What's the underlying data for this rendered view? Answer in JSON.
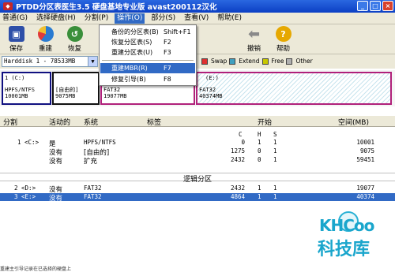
{
  "window": {
    "title": "PTDD分区表医生3.5 硬盘基地专业版 avast200112汉化"
  },
  "menu": [
    "普通(G)",
    "选择硬盘(H)",
    "分割(P)",
    "操作(O)",
    "部分(S)",
    "查看(V)",
    "帮助(E)"
  ],
  "toolbar": [
    {
      "label": "保存",
      "icon": "save-icon",
      "color": "#2e4fa8"
    },
    {
      "label": "重建",
      "icon": "rebuild-pie-icon",
      "color": "#2a7bd1"
    },
    {
      "label": "恢复",
      "icon": "restore-icon",
      "color": "#3a8f3a"
    },
    {
      "label": "撤销",
      "icon": "undo-arrow-icon",
      "color": "#8a8a8a"
    },
    {
      "label": "帮助",
      "icon": "help-icon",
      "color": "#e6a800"
    }
  ],
  "disk": {
    "selected": "Harddisk 1 - 78533MB"
  },
  "legend": [
    {
      "label": "Swap",
      "color": "#e03030"
    },
    {
      "label": "Extend",
      "color": "#40a0c0"
    },
    {
      "label": "Free",
      "color": "#c8c800"
    },
    {
      "label": "Other",
      "color": "#b0b0b0"
    }
  ],
  "diskmap": [
    {
      "line1": "1 (C:)",
      "line2": "HPFS/NTFS",
      "line3": "10001MB",
      "color": "#101080"
    },
    {
      "line1": "",
      "line2": "[自由的]",
      "line3": "9075MB",
      "color": "#111111"
    },
    {
      "line1": "",
      "line2": "FAT32",
      "line3": "19077MB",
      "color": "#b0207a"
    },
    {
      "line1": "(E:)",
      "line2": "FAT32",
      "line3": "40374MB",
      "color": "#b0207a"
    }
  ],
  "dropdown": {
    "items": [
      {
        "label": "备份的分区表(B)",
        "shortcut": "Shift+F1"
      },
      {
        "label": "恢复分区表(S)",
        "shortcut": "F2"
      },
      {
        "label": "重建分区表(U)",
        "shortcut": "F3"
      },
      {
        "label": "重建MBR(R)",
        "shortcut": "F7"
      },
      {
        "label": "修复引导(B)",
        "shortcut": "F8"
      }
    ]
  },
  "table": {
    "headers": {
      "split": "分割",
      "active": "活动的",
      "system": "系统",
      "label": "标签",
      "start": "开始",
      "space": "空间(MB)"
    },
    "chs": [
      "C",
      "H",
      "S"
    ],
    "primary": [
      {
        "split": "1 <C:>",
        "active": "是",
        "system": "HPFS/NTFS",
        "c": "0",
        "h": "1",
        "s": "1",
        "space": "10001"
      },
      {
        "split": "",
        "active": "没有",
        "system": "[自由的]",
        "c": "1275",
        "h": "0",
        "s": "1",
        "space": "9075"
      },
      {
        "split": "",
        "active": "没有",
        "system": "扩充",
        "c": "2432",
        "h": "0",
        "s": "1",
        "space": "59451"
      }
    ],
    "logical_title": "逻辑分区",
    "logical": [
      {
        "split": "2 <D:>",
        "active": "没有",
        "system": "FAT32",
        "c": "2432",
        "h": "1",
        "s": "1",
        "space": "19077"
      },
      {
        "split": "3 <E:>",
        "active": "没有",
        "system": "FAT32",
        "c": "4864",
        "h": "1",
        "s": "1",
        "space": "40374"
      }
    ]
  },
  "status": "重建主引导记录在已选择的硬盘上",
  "watermark": {
    "brand": "KHCoo",
    "cn": "科技库"
  }
}
